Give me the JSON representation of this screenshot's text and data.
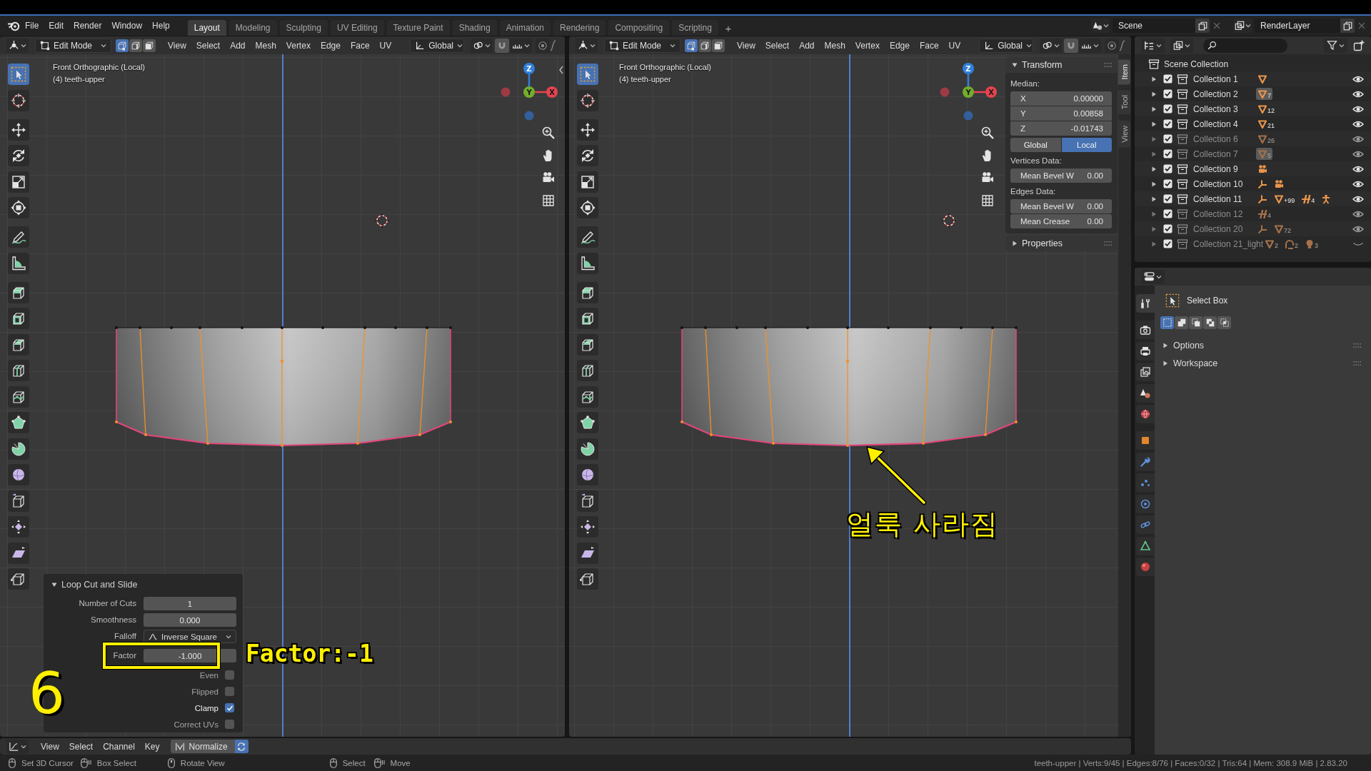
{
  "top_bar": {
    "menus": [
      "File",
      "Edit",
      "Render",
      "Window",
      "Help"
    ],
    "workspaces": [
      {
        "label": "Layout",
        "selected": true
      },
      {
        "label": "Modeling",
        "selected": false
      },
      {
        "label": "Sculpting",
        "selected": false
      },
      {
        "label": "UV Editing",
        "selected": false
      },
      {
        "label": "Texture Paint",
        "selected": false
      },
      {
        "label": "Shading",
        "selected": false
      },
      {
        "label": "Animation",
        "selected": false
      },
      {
        "label": "Rendering",
        "selected": false
      },
      {
        "label": "Compositing",
        "selected": false
      },
      {
        "label": "Scripting",
        "selected": false
      }
    ],
    "add_workspace": "+",
    "scene": "Scene",
    "view_layer": "RenderLayer"
  },
  "viewports": [
    {
      "mode": "Edit Mode",
      "select_modes": [
        {
          "kind": "vertex",
          "selected": true
        },
        {
          "kind": "edge",
          "selected": false
        },
        {
          "kind": "face",
          "selected": false
        }
      ],
      "menus": [
        "View",
        "Select",
        "Add",
        "Mesh",
        "Vertex",
        "Edge",
        "Face",
        "UV"
      ],
      "orientation": "Global",
      "view_name": "Front Orthographic (Local)",
      "object_name": "(4) teeth-upper",
      "gizmo": {
        "x": "X",
        "y": "Y",
        "z": "Z"
      },
      "toolbar": [
        {
          "tools": [
            {
              "kind": "select_box",
              "selected": true
            },
            {
              "kind": "cursor",
              "selected": false
            }
          ]
        },
        {
          "tools": [
            {
              "kind": "move",
              "selected": false
            },
            {
              "kind": "rotate",
              "selected": false
            },
            {
              "kind": "scale",
              "selected": false
            },
            {
              "kind": "transform",
              "selected": false
            }
          ]
        },
        {
          "tools": [
            {
              "kind": "annotate",
              "selected": false
            },
            {
              "kind": "measure",
              "selected": false
            }
          ]
        },
        {
          "tools": [
            {
              "kind": "extrude",
              "selected": false
            },
            {
              "kind": "inset",
              "selected": false
            },
            {
              "kind": "bevel",
              "selected": false
            },
            {
              "kind": "loop_cut",
              "selected": false
            },
            {
              "kind": "knife",
              "selected": false
            },
            {
              "kind": "poly_build",
              "selected": false
            },
            {
              "kind": "spin",
              "selected": false
            },
            {
              "kind": "smooth",
              "selected": false
            },
            {
              "kind": "edge_slide",
              "selected": false
            },
            {
              "kind": "shrink_fatten",
              "selected": false
            },
            {
              "kind": "shear",
              "selected": false
            },
            {
              "kind": "rip",
              "selected": false
            }
          ]
        }
      ],
      "operator": {
        "title": "Loop Cut and Slide",
        "expanded": true,
        "rows": [
          {
            "kind": "number",
            "label": "Number of Cuts",
            "value": "1",
            "annotated": false
          },
          {
            "kind": "number",
            "label": "Smoothness",
            "value": "0.000",
            "annotated": false
          },
          {
            "kind": "dropdown",
            "label": "Falloff",
            "value": "Inverse Square",
            "annotated": false
          },
          {
            "kind": "number",
            "label": "Factor",
            "value": "-1.000",
            "annotated": true
          },
          {
            "kind": "checkbox",
            "label": "Even",
            "checked": false,
            "annotated": false
          },
          {
            "kind": "checkbox",
            "label": "Flipped",
            "checked": false,
            "annotated": false
          },
          {
            "kind": "checkbox",
            "label": "Clamp",
            "checked": true,
            "annotated": false
          },
          {
            "kind": "checkbox",
            "label": "Correct UVs",
            "checked": false,
            "annotated": false
          }
        ]
      },
      "annotations": [
        {
          "kind": "callout",
          "text": "Factor:-1"
        },
        {
          "kind": "step_number",
          "text": "6"
        }
      ]
    },
    {
      "mode": "Edit Mode",
      "select_modes": [
        {
          "kind": "vertex",
          "selected": true
        },
        {
          "kind": "edge",
          "selected": false
        },
        {
          "kind": "face",
          "selected": false
        }
      ],
      "menus": [
        "View",
        "Select",
        "Add",
        "Mesh",
        "Vertex",
        "Edge",
        "Face",
        "UV"
      ],
      "orientation": "Global",
      "view_name": "Front Orthographic (Local)",
      "object_name": "(4) teeth-upper",
      "gizmo": {
        "x": "X",
        "y": "Y",
        "z": "Z"
      },
      "toolbar": [
        {
          "tools": [
            {
              "kind": "select_box",
              "selected": true
            },
            {
              "kind": "cursor",
              "selected": false
            }
          ]
        },
        {
          "tools": [
            {
              "kind": "move",
              "selected": false
            },
            {
              "kind": "rotate",
              "selected": false
            },
            {
              "kind": "scale",
              "selected": false
            },
            {
              "kind": "transform",
              "selected": false
            }
          ]
        },
        {
          "tools": [
            {
              "kind": "annotate",
              "selected": false
            },
            {
              "kind": "measure",
              "selected": false
            }
          ]
        },
        {
          "tools": [
            {
              "kind": "extrude",
              "selected": false
            },
            {
              "kind": "inset",
              "selected": false
            },
            {
              "kind": "bevel",
              "selected": false
            },
            {
              "kind": "loop_cut",
              "selected": false
            },
            {
              "kind": "knife",
              "selected": false
            },
            {
              "kind": "poly_build",
              "selected": false
            },
            {
              "kind": "spin",
              "selected": false
            },
            {
              "kind": "smooth",
              "selected": false
            },
            {
              "kind": "edge_slide",
              "selected": false
            },
            {
              "kind": "shrink_fatten",
              "selected": false
            },
            {
              "kind": "shear",
              "selected": false
            },
            {
              "kind": "rip",
              "selected": false
            }
          ]
        }
      ],
      "sidebar": {
        "tabs": [
          {
            "label": "Item",
            "selected": true
          },
          {
            "label": "Tool",
            "selected": false
          },
          {
            "label": "View",
            "selected": false
          }
        ],
        "transform": {
          "title": "Transform",
          "expanded": true,
          "median_label": "Median:",
          "median": [
            {
              "label": "X",
              "value": "0.00000"
            },
            {
              "label": "Y",
              "value": "0.00858"
            },
            {
              "label": "Z",
              "value": "-0.01743"
            }
          ],
          "space": [
            {
              "label": "Global",
              "selected": false
            },
            {
              "label": "Local",
              "selected": true
            }
          ],
          "vertices_label": "Vertices Data:",
          "vertex_fields": [
            {
              "label": "Mean Bevel W",
              "value": "0.00"
            }
          ],
          "edges_label": "Edges Data:",
          "edge_fields": [
            {
              "label": "Mean Bevel W",
              "value": "0.00"
            },
            {
              "label": "Mean Crease",
              "value": "0.00"
            }
          ]
        },
        "properties": {
          "title": "Properties",
          "expanded": false
        }
      },
      "annotations": [
        {
          "kind": "arrow_note",
          "text": "얼룩 사라짐"
        }
      ]
    }
  ],
  "outliner": {
    "root": "Scene Collection",
    "collections": [
      {
        "label": "Collection 1",
        "checked": true,
        "dimmed": false,
        "visible": true,
        "objects": [
          {
            "kind": "mesh",
            "highlighted": false
          }
        ]
      },
      {
        "label": "Collection 2",
        "checked": true,
        "dimmed": false,
        "visible": true,
        "objects": [
          {
            "kind": "mesh",
            "count": "7",
            "highlighted": true
          }
        ]
      },
      {
        "label": "Collection 3",
        "checked": true,
        "dimmed": false,
        "visible": true,
        "objects": [
          {
            "kind": "mesh",
            "count": "12",
            "highlighted": false
          }
        ]
      },
      {
        "label": "Collection 4",
        "checked": true,
        "dimmed": false,
        "visible": true,
        "objects": [
          {
            "kind": "mesh",
            "count": "21",
            "highlighted": false
          }
        ]
      },
      {
        "label": "Collection 6",
        "checked": true,
        "dimmed": true,
        "visible": true,
        "objects": [
          {
            "kind": "mesh",
            "count": "26",
            "highlighted": false
          }
        ]
      },
      {
        "label": "Collection 7",
        "checked": true,
        "dimmed": true,
        "visible": true,
        "objects": [
          {
            "kind": "mesh",
            "count": "5",
            "highlighted": true
          }
        ]
      },
      {
        "label": "Collection 9",
        "checked": true,
        "dimmed": false,
        "visible": true,
        "objects": [
          {
            "kind": "camera",
            "highlighted": false
          }
        ]
      },
      {
        "label": "Collection 10",
        "checked": true,
        "dimmed": false,
        "visible": true,
        "objects": [
          {
            "kind": "empty",
            "highlighted": false
          },
          {
            "kind": "camera",
            "highlighted": false
          }
        ]
      },
      {
        "label": "Collection 11",
        "checked": true,
        "dimmed": false,
        "visible": true,
        "objects": [
          {
            "kind": "empty",
            "highlighted": false
          },
          {
            "kind": "mesh",
            "count": "+99",
            "highlighted": false
          },
          {
            "kind": "strands",
            "count": "4",
            "highlighted": false
          },
          {
            "kind": "armature",
            "highlighted": false
          }
        ]
      },
      {
        "label": "Collection 12",
        "checked": true,
        "dimmed": true,
        "visible": true,
        "objects": [
          {
            "kind": "strands",
            "count": "4",
            "highlighted": false
          }
        ]
      },
      {
        "label": "Collection 20",
        "checked": true,
        "dimmed": true,
        "visible": true,
        "objects": [
          {
            "kind": "empty",
            "highlighted": false
          },
          {
            "kind": "mesh",
            "count": "72",
            "highlighted": false
          }
        ]
      },
      {
        "label": "Collection 21_light",
        "checked": true,
        "dimmed": true,
        "visible": false,
        "objects": [
          {
            "kind": "mesh",
            "count": "2",
            "highlighted": false
          },
          {
            "kind": "probe",
            "count": "2",
            "highlighted": false
          },
          {
            "kind": "light",
            "count": "3",
            "highlighted": false
          }
        ]
      }
    ]
  },
  "properties_editor": {
    "tabs": [
      {
        "kind": "tool",
        "selected": true
      },
      {
        "kind": "render",
        "selected": false
      },
      {
        "kind": "output",
        "selected": false
      },
      {
        "kind": "view_layer",
        "selected": false
      },
      {
        "kind": "scene",
        "selected": false
      },
      {
        "kind": "world",
        "selected": false
      },
      {
        "kind": "object",
        "selected": false
      },
      {
        "kind": "modifiers",
        "selected": false
      },
      {
        "kind": "particles",
        "selected": false
      },
      {
        "kind": "physics",
        "selected": false
      },
      {
        "kind": "constraints",
        "selected": false
      },
      {
        "kind": "data",
        "selected": false
      },
      {
        "kind": "material",
        "selected": false
      }
    ],
    "tool": {
      "kind": "select_box",
      "name": "Select Box"
    },
    "box_modes": [
      {
        "kind": "set",
        "selected": true
      },
      {
        "kind": "extend",
        "selected": false
      },
      {
        "kind": "subtract",
        "selected": false
      },
      {
        "kind": "difference",
        "selected": false
      },
      {
        "kind": "intersect",
        "selected": false
      }
    ],
    "panels": [
      {
        "title": "Options",
        "expanded": false
      },
      {
        "title": "Workspace",
        "expanded": false
      }
    ]
  },
  "timeline": {
    "menus": [
      "View",
      "Select",
      "Channel",
      "Key"
    ],
    "normalize": "Normalize",
    "only_selected": true
  },
  "status_bar": {
    "hints": [
      {
        "kind": "click",
        "label": "Set 3D Cursor"
      },
      {
        "kind": "drag",
        "label": "Box Select"
      },
      {
        "kind": "middle",
        "label": "Rotate View"
      },
      {
        "kind": "click",
        "label": "Select"
      },
      {
        "kind": "drag",
        "label": "Move"
      }
    ],
    "stats": "teeth-upper | Verts:9/45 | Edges:8/76 | Faces:0/32 | Tris:64 | Mem: 308.9 MiB | 2.83.20"
  }
}
